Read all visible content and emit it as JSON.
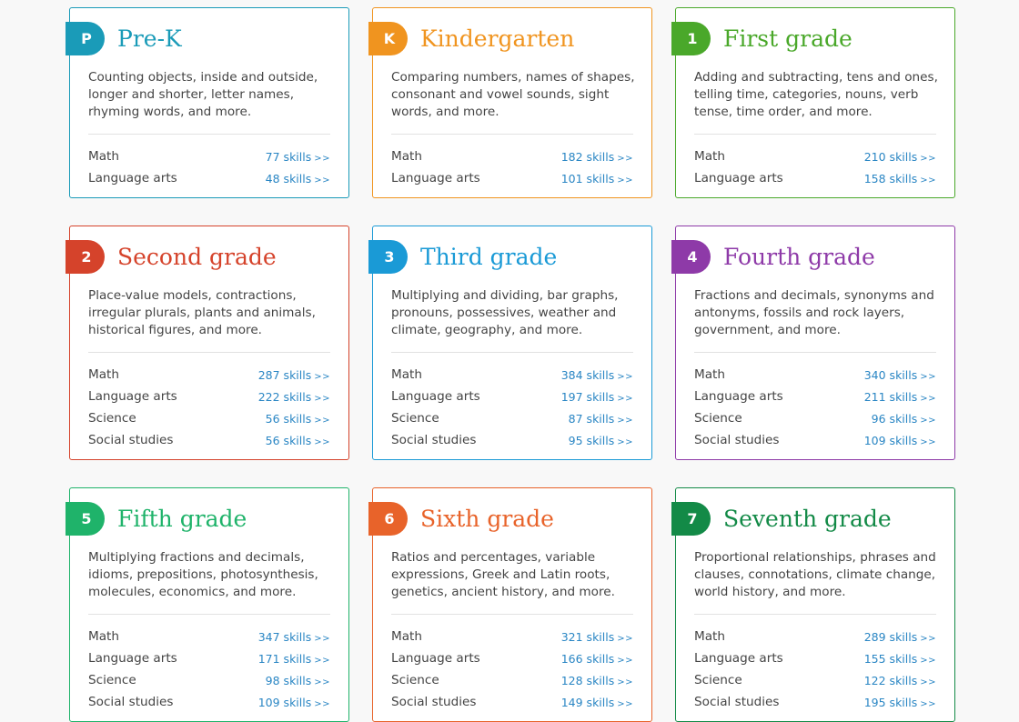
{
  "grades": [
    {
      "badge": "P",
      "title": "Pre-K",
      "color": "#1a9bb8",
      "description": "Counting objects, inside and outside, longer and shorter, letter names, rhyming words, and more.",
      "subjects": [
        {
          "name": "Math",
          "skills": "77 skills"
        },
        {
          "name": "Language arts",
          "skills": "48 skills"
        }
      ]
    },
    {
      "badge": "K",
      "title": "Kindergarten",
      "color": "#f0941f",
      "description": "Comparing numbers, names of shapes, consonant and vowel sounds, sight words, and more.",
      "subjects": [
        {
          "name": "Math",
          "skills": "182 skills"
        },
        {
          "name": "Language arts",
          "skills": "101 skills"
        }
      ]
    },
    {
      "badge": "1",
      "title": "First grade",
      "color": "#4aa82a",
      "description": "Adding and subtracting, tens and ones, telling time, categories, nouns, verb tense, time order, and more.",
      "subjects": [
        {
          "name": "Math",
          "skills": "210 skills"
        },
        {
          "name": "Language arts",
          "skills": "158 skills"
        }
      ]
    },
    {
      "badge": "2",
      "title": "Second grade",
      "color": "#d5432b",
      "description": "Place-value models, contractions, irregular plurals, plants and animals, historical figures, and more.",
      "subjects": [
        {
          "name": "Math",
          "skills": "287 skills"
        },
        {
          "name": "Language arts",
          "skills": "222 skills"
        },
        {
          "name": "Science",
          "skills": "56 skills"
        },
        {
          "name": "Social studies",
          "skills": "56 skills"
        }
      ]
    },
    {
      "badge": "3",
      "title": "Third grade",
      "color": "#1a9ad6",
      "description": "Multiplying and dividing, bar graphs, pronouns, possessives, weather and climate, geography, and more.",
      "subjects": [
        {
          "name": "Math",
          "skills": "384 skills"
        },
        {
          "name": "Language arts",
          "skills": "197 skills"
        },
        {
          "name": "Science",
          "skills": "87 skills"
        },
        {
          "name": "Social studies",
          "skills": "95 skills"
        }
      ]
    },
    {
      "badge": "4",
      "title": "Fourth grade",
      "color": "#8e3aa8",
      "description": "Fractions and decimals, synonyms and antonyms, fossils and rock layers, government, and more.",
      "subjects": [
        {
          "name": "Math",
          "skills": "340 skills"
        },
        {
          "name": "Language arts",
          "skills": "211 skills"
        },
        {
          "name": "Science",
          "skills": "96 skills"
        },
        {
          "name": "Social studies",
          "skills": "109 skills"
        }
      ]
    },
    {
      "badge": "5",
      "title": "Fifth grade",
      "color": "#1fb36a",
      "description": "Multiplying fractions and decimals, idioms, prepositions, photosynthesis, molecules, economics, and more.",
      "subjects": [
        {
          "name": "Math",
          "skills": "347 skills"
        },
        {
          "name": "Language arts",
          "skills": "171 skills"
        },
        {
          "name": "Science",
          "skills": "98 skills"
        },
        {
          "name": "Social studies",
          "skills": "109 skills"
        }
      ]
    },
    {
      "badge": "6",
      "title": "Sixth grade",
      "color": "#e8632a",
      "description": "Ratios and percentages, variable expressions, Greek and Latin roots, genetics, ancient history, and more.",
      "subjects": [
        {
          "name": "Math",
          "skills": "321 skills"
        },
        {
          "name": "Language arts",
          "skills": "166 skills"
        },
        {
          "name": "Science",
          "skills": "128 skills"
        },
        {
          "name": "Social studies",
          "skills": "149 skills"
        }
      ]
    },
    {
      "badge": "7",
      "title": "Seventh grade",
      "color": "#138a47",
      "description": "Proportional relationships, phrases and clauses, connotations, climate change, world history, and more.",
      "subjects": [
        {
          "name": "Math",
          "skills": "289 skills"
        },
        {
          "name": "Language arts",
          "skills": "155 skills"
        },
        {
          "name": "Science",
          "skills": "122 skills"
        },
        {
          "name": "Social studies",
          "skills": "195 skills"
        }
      ]
    }
  ],
  "link_arrow": ">>"
}
